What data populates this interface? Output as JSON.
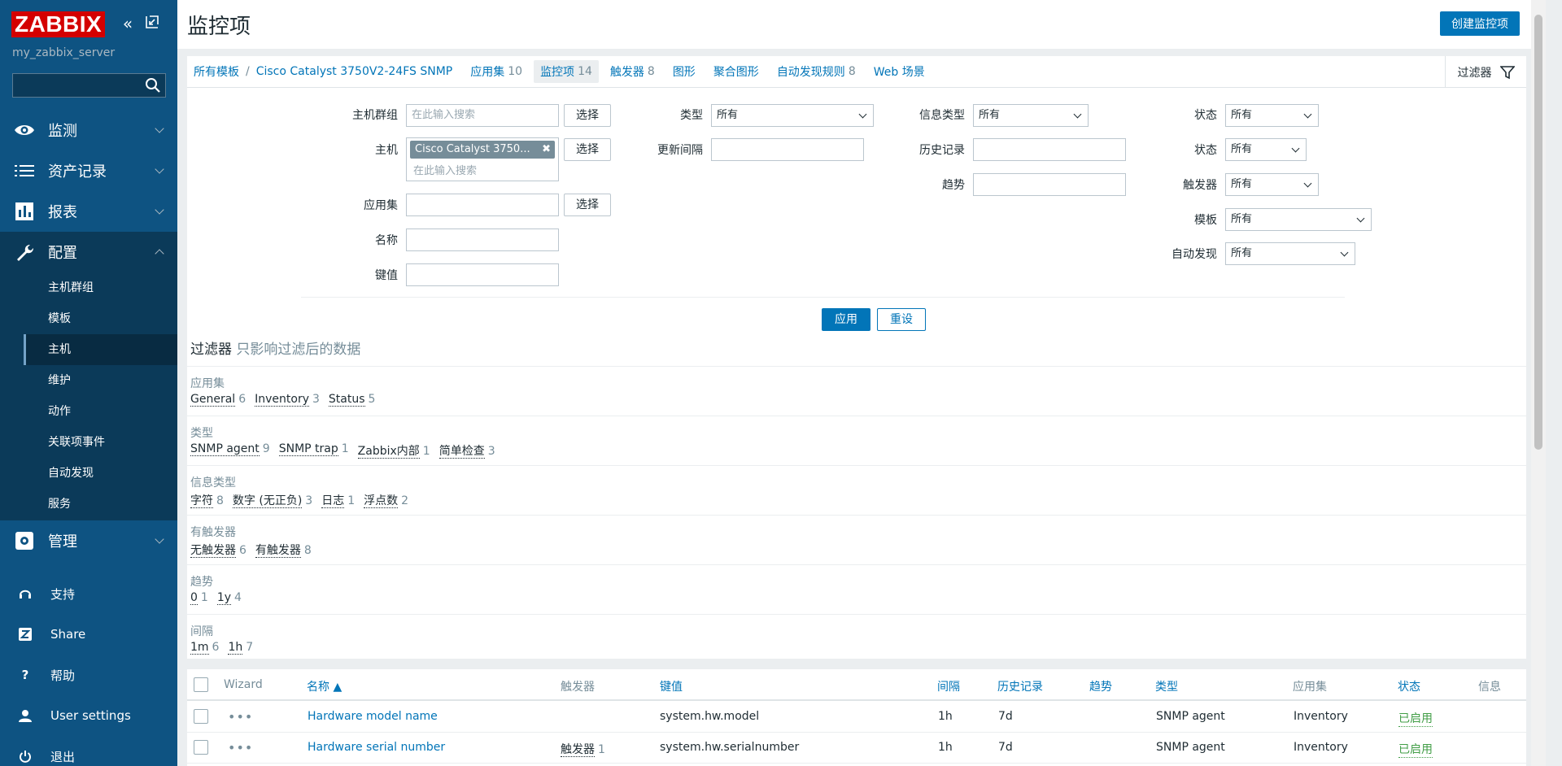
{
  "sidebar": {
    "logo": "ZABBIX",
    "server_name": "my_zabbix_server",
    "search_placeholder": "",
    "menu": {
      "monitoring": "监测",
      "inventory": "资产记录",
      "reports": "报表",
      "configuration": "配置",
      "administration": "管理"
    },
    "submenu": [
      "主机群组",
      "模板",
      "主机",
      "维护",
      "动作",
      "关联项事件",
      "自动发现",
      "服务"
    ],
    "selected_submenu": "主机",
    "bottom": {
      "support": "支持",
      "share": "Share",
      "help": "帮助",
      "user_settings": "User settings",
      "logout": "退出"
    }
  },
  "header": {
    "title": "监控项",
    "create_button": "创建监控项"
  },
  "nav": {
    "all_templates": "所有模板",
    "separator": "/",
    "host": "Cisco Catalyst 3750V2-24FS SNMP",
    "tabs": [
      {
        "label": "应用集",
        "count": "10"
      },
      {
        "label": "监控项",
        "count": "14"
      },
      {
        "label": "触发器",
        "count": "8"
      },
      {
        "label": "图形",
        "count": ""
      },
      {
        "label": "聚合图形",
        "count": ""
      },
      {
        "label": "自动发现规则",
        "count": "8"
      },
      {
        "label": "Web 场景",
        "count": ""
      }
    ],
    "filter_tab": "过滤器"
  },
  "filter": {
    "host_group_label": "主机群组",
    "host_label": "主机",
    "app_label": "应用集",
    "name_label": "名称",
    "key_label": "键值",
    "search_placeholder": "在此输入搜索",
    "select_button": "选择",
    "host_chip": "Cisco Catalyst 3750...",
    "type_label": "类型",
    "interval_label": "更新间隔",
    "info_type_label": "信息类型",
    "history_label": "历史记录",
    "trends_label": "趋势",
    "state_label": "状态",
    "status_label": "状态",
    "triggers_label": "触发器",
    "template_label": "模板",
    "discovery_label": "自动发现",
    "all_option": "所有",
    "apply": "应用",
    "reset": "重设"
  },
  "subfilter": {
    "title": "过滤器",
    "hint": "只影响过滤后的数据",
    "groups": [
      {
        "name": "应用集",
        "values": [
          {
            "t": "General",
            "c": "6"
          },
          {
            "t": "Inventory",
            "c": "3"
          },
          {
            "t": "Status",
            "c": "5"
          }
        ]
      },
      {
        "name": "类型",
        "values": [
          {
            "t": "SNMP agent",
            "c": "9"
          },
          {
            "t": "SNMP trap",
            "c": "1"
          },
          {
            "t": "Zabbix内部",
            "c": "1"
          },
          {
            "t": "简单检查",
            "c": "3"
          }
        ]
      },
      {
        "name": "信息类型",
        "values": [
          {
            "t": "字符",
            "c": "8"
          },
          {
            "t": "数字 (无正负)",
            "c": "3"
          },
          {
            "t": "日志",
            "c": "1"
          },
          {
            "t": "浮点数",
            "c": "2"
          }
        ]
      },
      {
        "name": "有触发器",
        "values": [
          {
            "t": "无触发器",
            "c": "6"
          },
          {
            "t": "有触发器",
            "c": "8"
          }
        ]
      },
      {
        "name": "趋势",
        "values": [
          {
            "t": "0",
            "c": "1"
          },
          {
            "t": "1y",
            "c": "4"
          }
        ]
      },
      {
        "name": "间隔",
        "values": [
          {
            "t": "1m",
            "c": "6"
          },
          {
            "t": "1h",
            "c": "7"
          }
        ]
      }
    ]
  },
  "table": {
    "headers": {
      "wizard": "Wizard",
      "name": "名称 ▲",
      "triggers": "触发器",
      "key": "键值",
      "interval": "间隔",
      "history": "历史记录",
      "trends": "趋势",
      "type": "类型",
      "applications": "应用集",
      "status": "状态",
      "info": "信息"
    },
    "rows": [
      {
        "name": "Hardware model name",
        "triggers": "",
        "trig_count": "",
        "key": "system.hw.model",
        "interval": "1h",
        "history": "7d",
        "trends": "",
        "type": "SNMP agent",
        "app": "Inventory",
        "status": "已启用"
      },
      {
        "name": "Hardware serial number",
        "triggers": "触发器",
        "trig_count": "1",
        "key": "system.hw.serialnumber",
        "interval": "1h",
        "history": "7d",
        "trends": "",
        "type": "SNMP agent",
        "app": "Inventory",
        "status": "已启用"
      }
    ]
  },
  "colors": {
    "sidebar": "#0e5382",
    "sidebar_dark": "#0b3a59",
    "link": "#0275b8",
    "brand_red": "#d40000",
    "enabled_green": "#429e47"
  }
}
